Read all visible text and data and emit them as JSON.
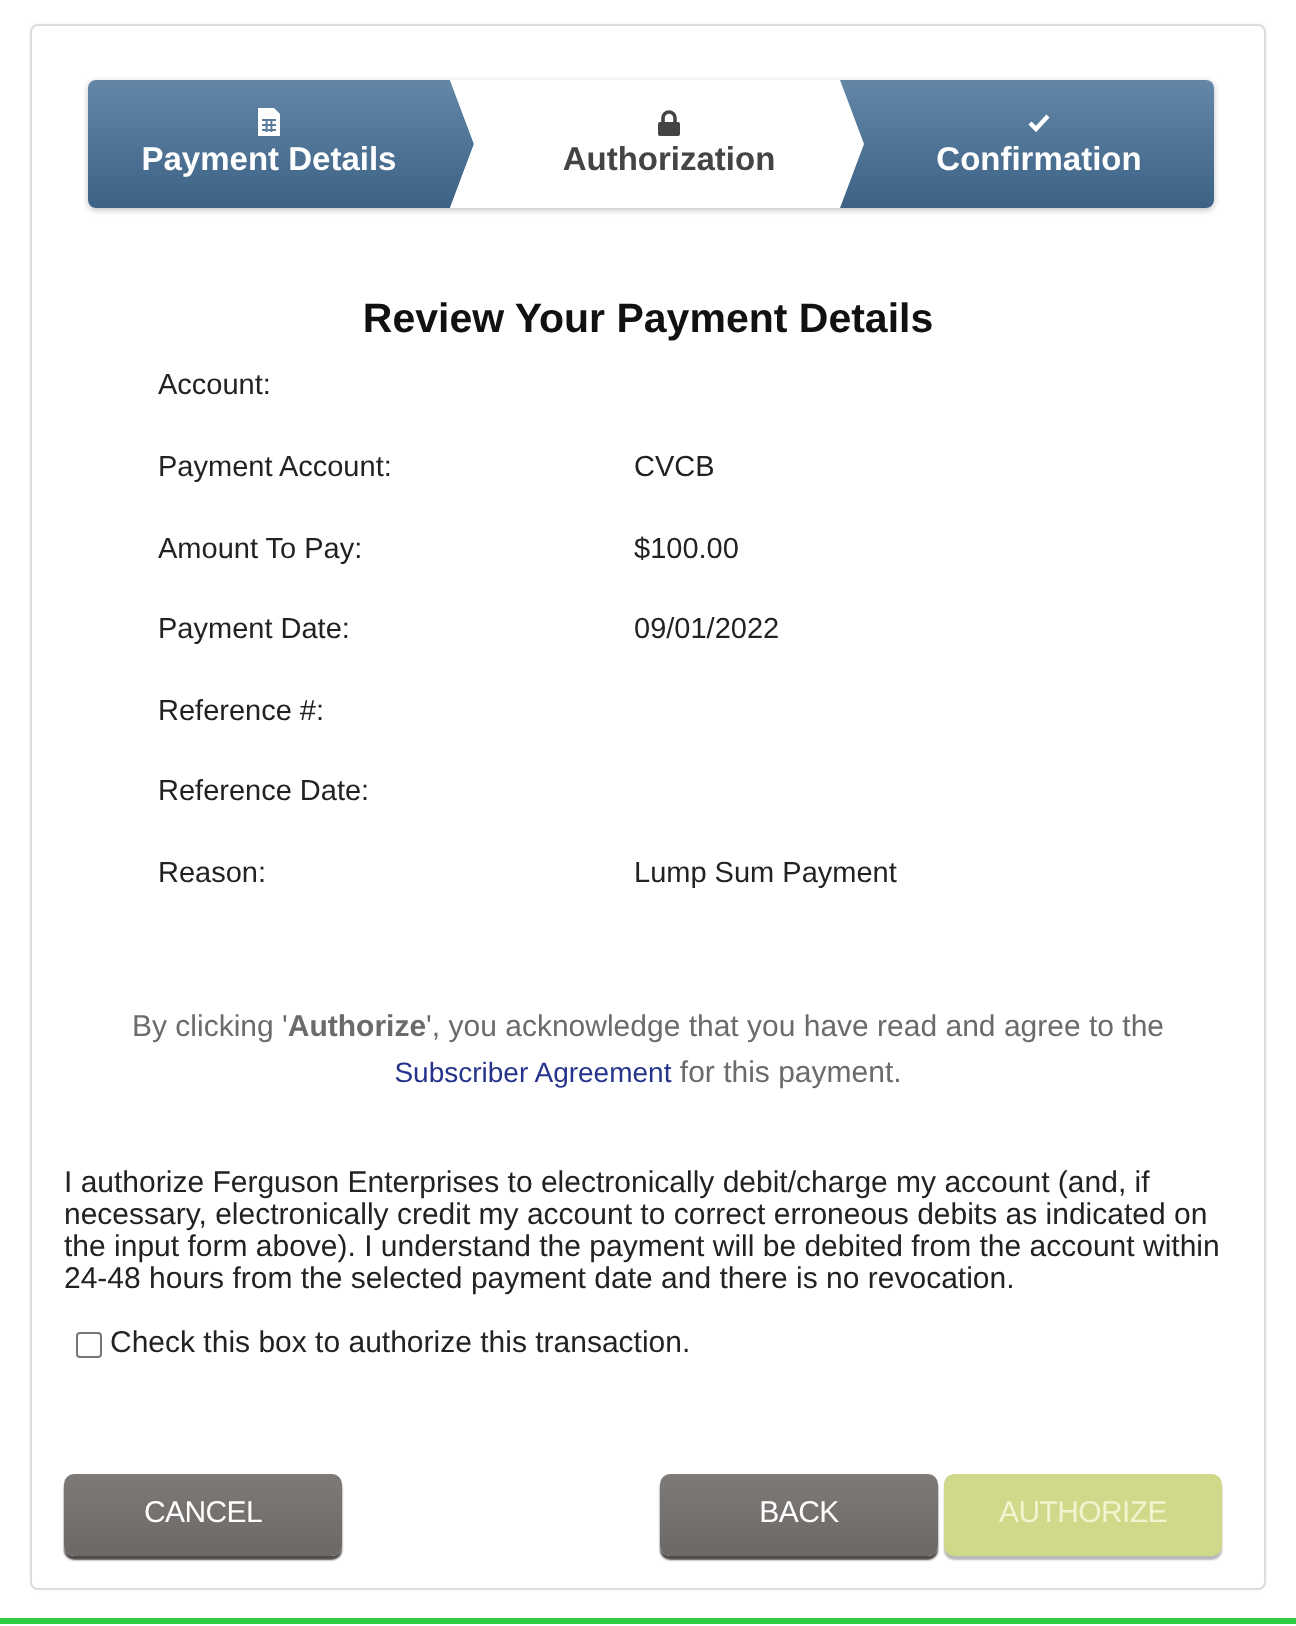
{
  "steps": [
    {
      "label": "Payment Details",
      "selected": false
    },
    {
      "label": "Authorization",
      "selected": true
    },
    {
      "label": "Confirmation",
      "selected": false
    }
  ],
  "review": {
    "title": "Review Your Payment Details",
    "rows": [
      {
        "label": "Account:"
      },
      {
        "label": "Payment Account:",
        "value": "CVCB"
      },
      {
        "label": "Amount To Pay:",
        "value": "$100.00"
      },
      {
        "label": "Payment Date:",
        "value": "09/01/2022"
      },
      {
        "label": "Reference #:"
      },
      {
        "label": "Reference Date:"
      },
      {
        "label": "Reason:",
        "value": "Lump Sum Payment"
      }
    ]
  },
  "notice": {
    "text": "By clicking '**Authorize**', you acknowledge that you have read and agree to the",
    "link": "Subscriber Agreement",
    "after": "for this payment."
  },
  "authorization": {
    "text": "I authorize Ferguson Enterprises to electronically debit/charge my account (and, if necessary, electronically credit my account to correct erroneous debits as indicated on the input form above). I understand the payment will be debited from the account within 24-48 hours from the selected payment date and there is no revocation.",
    "checkbox": {
      "label": "Check this box to authorize this transaction.",
      "checked": false
    }
  },
  "buttons": [
    {
      "label": "CANCEL",
      "kind": "secondary",
      "disabled": false
    },
    {
      "label": "BACK",
      "kind": "secondary",
      "disabled": false
    },
    {
      "label": "AUTHORIZE",
      "kind": "primary",
      "disabled": true
    }
  ]
}
